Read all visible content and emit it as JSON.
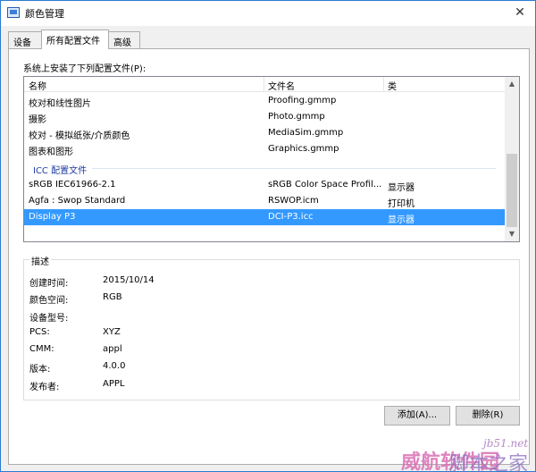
{
  "window": {
    "title": "颜色管理",
    "close_glyph": "✕"
  },
  "tabs": [
    {
      "label": "设备"
    },
    {
      "label": "所有配置文件"
    },
    {
      "label": "高级"
    }
  ],
  "profile_list": {
    "caption": "系统上安装了下列配置文件(P):",
    "columns": [
      "名称",
      "文件名",
      "类"
    ],
    "rows_top": [
      {
        "name": "校对和线性图片",
        "file": "Proofing.gmmp",
        "class": ""
      },
      {
        "name": "摄影",
        "file": "Photo.gmmp",
        "class": ""
      },
      {
        "name": "校对 - 模拟纸张/介质颜色",
        "file": "MediaSim.gmmp",
        "class": ""
      },
      {
        "name": "图表和图形",
        "file": "Graphics.gmmp",
        "class": ""
      }
    ],
    "group_label": "ICC 配置文件",
    "rows_icc": [
      {
        "name": "sRGB IEC61966-2.1",
        "file": "sRGB Color Space Profil...",
        "class": "显示器"
      },
      {
        "name": "Agfa : Swop Standard",
        "file": "RSWOP.icm",
        "class": "打印机"
      },
      {
        "name": "Display P3",
        "file": "DCI-P3.icc",
        "class": "显示器"
      }
    ],
    "selected_row": "Display P3",
    "scroll_up_glyph": "▲",
    "scroll_down_glyph": "▼"
  },
  "description": {
    "title": "描述",
    "props": [
      {
        "label": "创建时间:",
        "value": "2015/10/14"
      },
      {
        "label": "颜色空间:",
        "value": "RGB"
      },
      {
        "label": "设备型号:",
        "value": ""
      },
      {
        "label": "PCS:",
        "value": "XYZ"
      },
      {
        "label": "CMM:",
        "value": "appl"
      },
      {
        "label": "版本:",
        "value": "4.0.0"
      },
      {
        "label": "发布者:",
        "value": "APPL"
      }
    ]
  },
  "buttons": {
    "add": "添加(A)...",
    "delete": "删除(R)"
  },
  "watermark": {
    "url": "jb51.net",
    "text1": "威航软件园",
    "text2": "脚本之家"
  },
  "colors": {
    "selection": "#3399ff",
    "group_header": "#1e3d9e",
    "window_border": "#2b7bd1"
  }
}
